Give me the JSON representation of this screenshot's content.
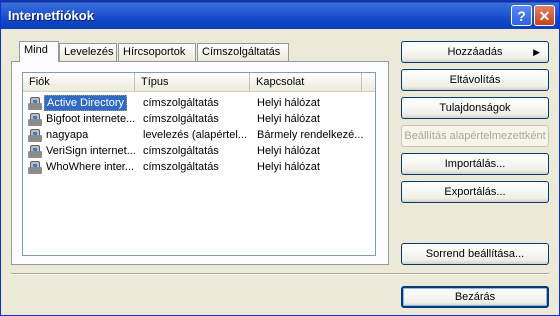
{
  "window": {
    "title": "Internetfiókok"
  },
  "titlebar_buttons": {
    "help": "?",
    "close": "✕"
  },
  "tabs": [
    {
      "label": "Mind",
      "active": true
    },
    {
      "label": "Levelezés",
      "active": false
    },
    {
      "label": "Hírcsoportok",
      "active": false
    },
    {
      "label": "Címszolgáltatás",
      "active": false
    }
  ],
  "list": {
    "columns": [
      "Fiók",
      "Típus",
      "Kapcsolat"
    ],
    "rows": [
      {
        "name": "Active Directory",
        "type": "címszolgáltatás",
        "connection": "Helyi hálózat",
        "selected": true,
        "icon": "directory-service-icon"
      },
      {
        "name": "Bigfoot internete...",
        "type": "címszolgáltatás",
        "connection": "Helyi hálózat",
        "selected": false,
        "icon": "directory-service-icon"
      },
      {
        "name": "nagyapa",
        "type": "levelezés (alapértel...",
        "connection": "Bármely rendelkezé...",
        "selected": false,
        "icon": "mail-account-icon"
      },
      {
        "name": "VeriSign internet...",
        "type": "címszolgáltatás",
        "connection": "Helyi hálózat",
        "selected": false,
        "icon": "directory-service-icon"
      },
      {
        "name": "WhoWhere inter...",
        "type": "címszolgáltatás",
        "connection": "Helyi hálózat",
        "selected": false,
        "icon": "directory-service-icon"
      }
    ]
  },
  "buttons": {
    "add": "Hozzáadás",
    "remove": "Eltávolítás",
    "properties": "Tulajdonságok",
    "set_default": "Beállítás alapértelmezettként",
    "import": "Importálás...",
    "export": "Exportálás...",
    "order": "Sorrend beállítása...",
    "close": "Bezárás"
  }
}
